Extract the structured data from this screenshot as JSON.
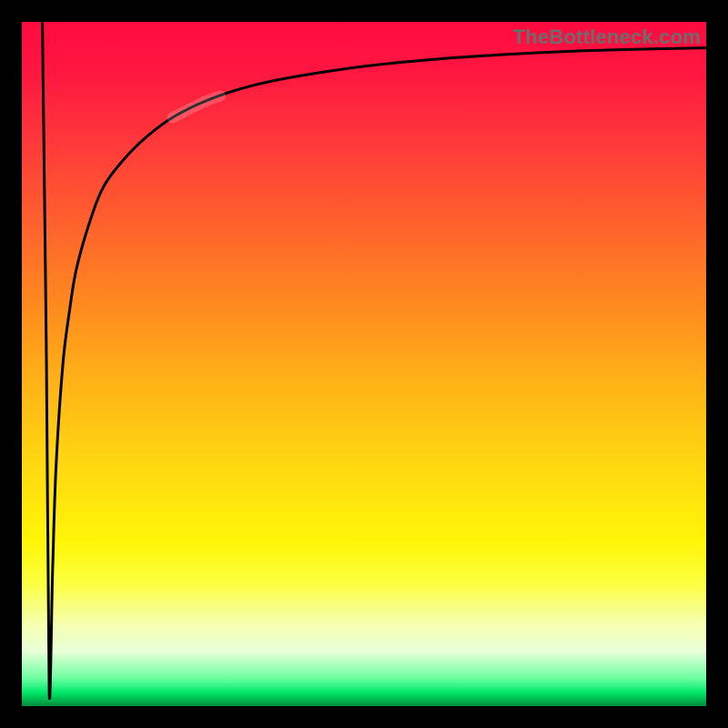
{
  "watermark": "TheBottleneck.com",
  "colors": {
    "frame": "#000000",
    "watermark": "#6c6c6c",
    "curve": "#000000",
    "highlight": "rgba(255,255,255,0.35)"
  },
  "chart_data": {
    "type": "line",
    "title": "",
    "xlabel": "",
    "ylabel": "",
    "xlim": [
      0,
      100
    ],
    "ylim": [
      0,
      100
    ],
    "grid": false,
    "legend": false,
    "x": [
      3,
      3.6,
      4,
      4.5,
      5,
      6,
      7,
      8,
      10,
      12,
      15,
      18,
      22,
      27,
      33,
      40,
      50,
      60,
      70,
      80,
      90,
      100
    ],
    "values": [
      100,
      50,
      2,
      20,
      35,
      50,
      58,
      64,
      71,
      76,
      80,
      83,
      86,
      88.5,
      90.5,
      92,
      93.5,
      94.5,
      95.2,
      95.7,
      96,
      96.2
    ],
    "highlight_segment": {
      "x_start": 22,
      "x_end": 29
    }
  }
}
